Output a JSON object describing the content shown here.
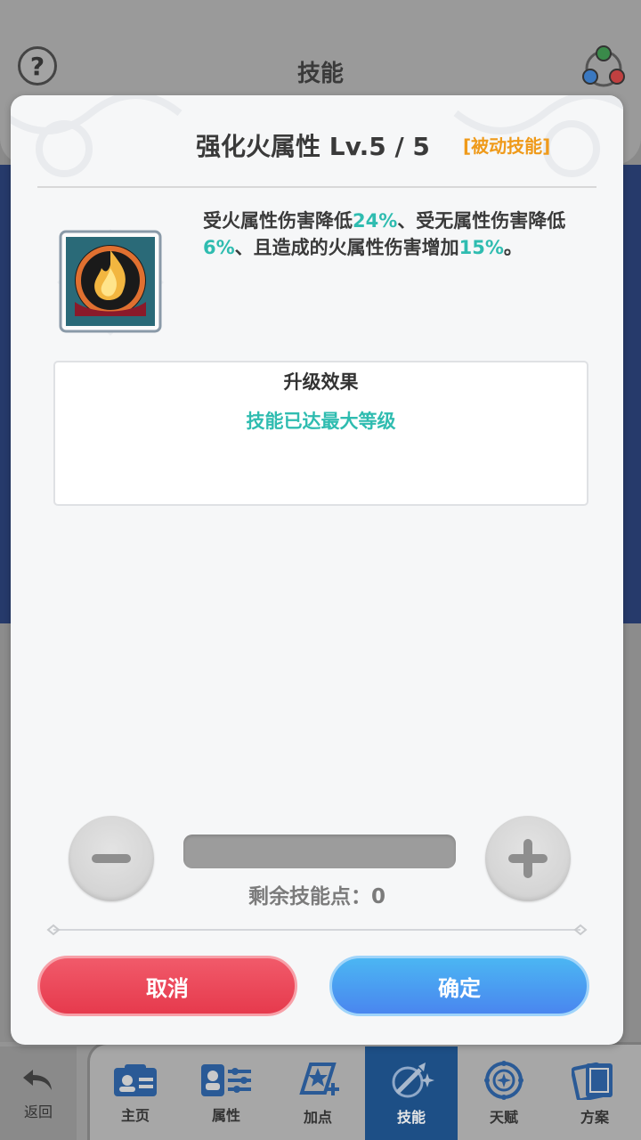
{
  "header": {
    "title": "技能"
  },
  "dialog": {
    "skill_name": "强化火属性",
    "level_text": "Lv.5 / 5",
    "type_tag": "[被动技能]",
    "description": {
      "p1": "受火属性伤害降低",
      "v1": "24%",
      "p2": "、受无属性伤害降低",
      "v2": "6%",
      "p3": "、且造成的火属性伤害增加",
      "v3": "15%",
      "p4": "。"
    },
    "upgrade": {
      "title": "升级效果",
      "status": "技能已达最大等级"
    },
    "remaining_points_label": "剩余技能点：",
    "remaining_points": "0",
    "cancel_label": "取消",
    "confirm_label": "确定"
  },
  "bottom_nav": {
    "back_label": "返回",
    "items": [
      {
        "label": "主页",
        "icon": "id-card-icon"
      },
      {
        "label": "属性",
        "icon": "attributes-icon"
      },
      {
        "label": "加点",
        "icon": "add-points-icon"
      },
      {
        "label": "技能",
        "icon": "skill-icon",
        "active": true
      },
      {
        "label": "天赋",
        "icon": "talent-icon"
      },
      {
        "label": "方案",
        "icon": "cards-icon"
      }
    ]
  },
  "colors": {
    "highlight": "#2fbcb0",
    "tag": "#ef9a1a",
    "cancel": "#e63a4d",
    "confirm": "#4a86ef",
    "nav_active": "#1d4f86"
  }
}
